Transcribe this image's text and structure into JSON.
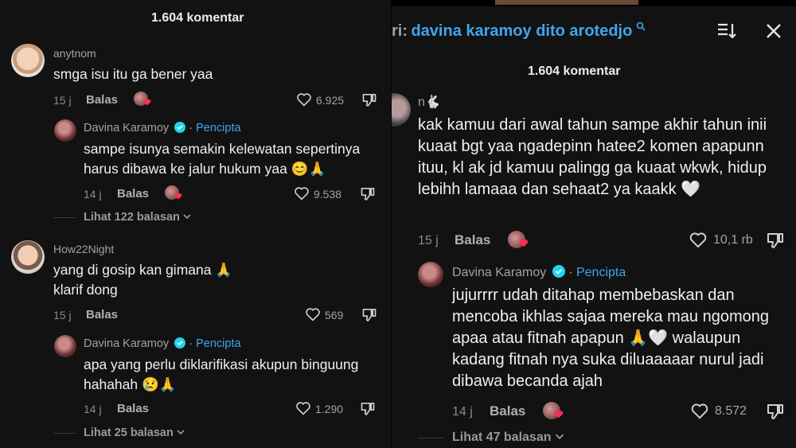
{
  "left": {
    "count_label": "1.604 komentar",
    "comments": [
      {
        "username": "anytnom",
        "text": "smga isu itu ga bener yaa",
        "time": "15 j",
        "reply_label": "Balas",
        "likes": "6.925"
      },
      {
        "username": "How22Night",
        "text": "yang di gosip kan gimana 🙏 klarif dong",
        "time": "15 j",
        "reply_label": "Balas",
        "likes": "569"
      }
    ],
    "creator_replies": [
      {
        "name": "Davina Karamoy",
        "creator_label": "Pencipta",
        "text": "sampe isunya semakin kelewatan sepertinya harus dibawa ke jalur hukum yaa 😊🙏",
        "time": "14 j",
        "reply_label": "Balas",
        "likes": "9.538",
        "view_replies": "Lihat 122 balasan"
      },
      {
        "name": "Davina Karamoy",
        "creator_label": "Pencipta",
        "text": "apa yang perlu diklarifikasi akupun binguung hahahah 😢🙏",
        "time": "14 j",
        "reply_label": "Balas",
        "likes": "1.290",
        "view_replies": "Lihat 25 balasan"
      }
    ]
  },
  "right": {
    "search_prefix": "ri:",
    "search_query": "davina karamoy dito arotedjo",
    "count_label": "1.604 komentar",
    "comment": {
      "username": "n🐇",
      "text": "kak kamuu dari awal tahun sampe akhir tahun inii kuaat bgt yaa ngadepinn hatee2 komen apapunn ituu, kl ak jd kamuu palingg ga kuaat wkwk, hidup lebihh lamaaa dan sehaat2 ya kaakk 🤍",
      "time": "15 j",
      "reply_label": "Balas",
      "likes": "10,1 rb"
    },
    "creator_reply": {
      "name": "Davina Karamoy",
      "creator_label": "Pencipta",
      "text": "jujurrrr udah ditahap membebaskan dan mencoba ikhlas sajaa mereka mau ngomong apaa atau fitnah apapun 🙏🤍 walaupun kadang fitnah nya suka diluaaaaar nurul jadi dibawa becanda ajah",
      "time": "14 j",
      "reply_label": "Balas",
      "likes": "8.572",
      "view_replies": "Lihat 47 balasan"
    }
  },
  "colors": {
    "accent": "#3fa5f0",
    "background": "#121212",
    "text": "#f0f0f0",
    "muted": "#8a8a8a"
  }
}
